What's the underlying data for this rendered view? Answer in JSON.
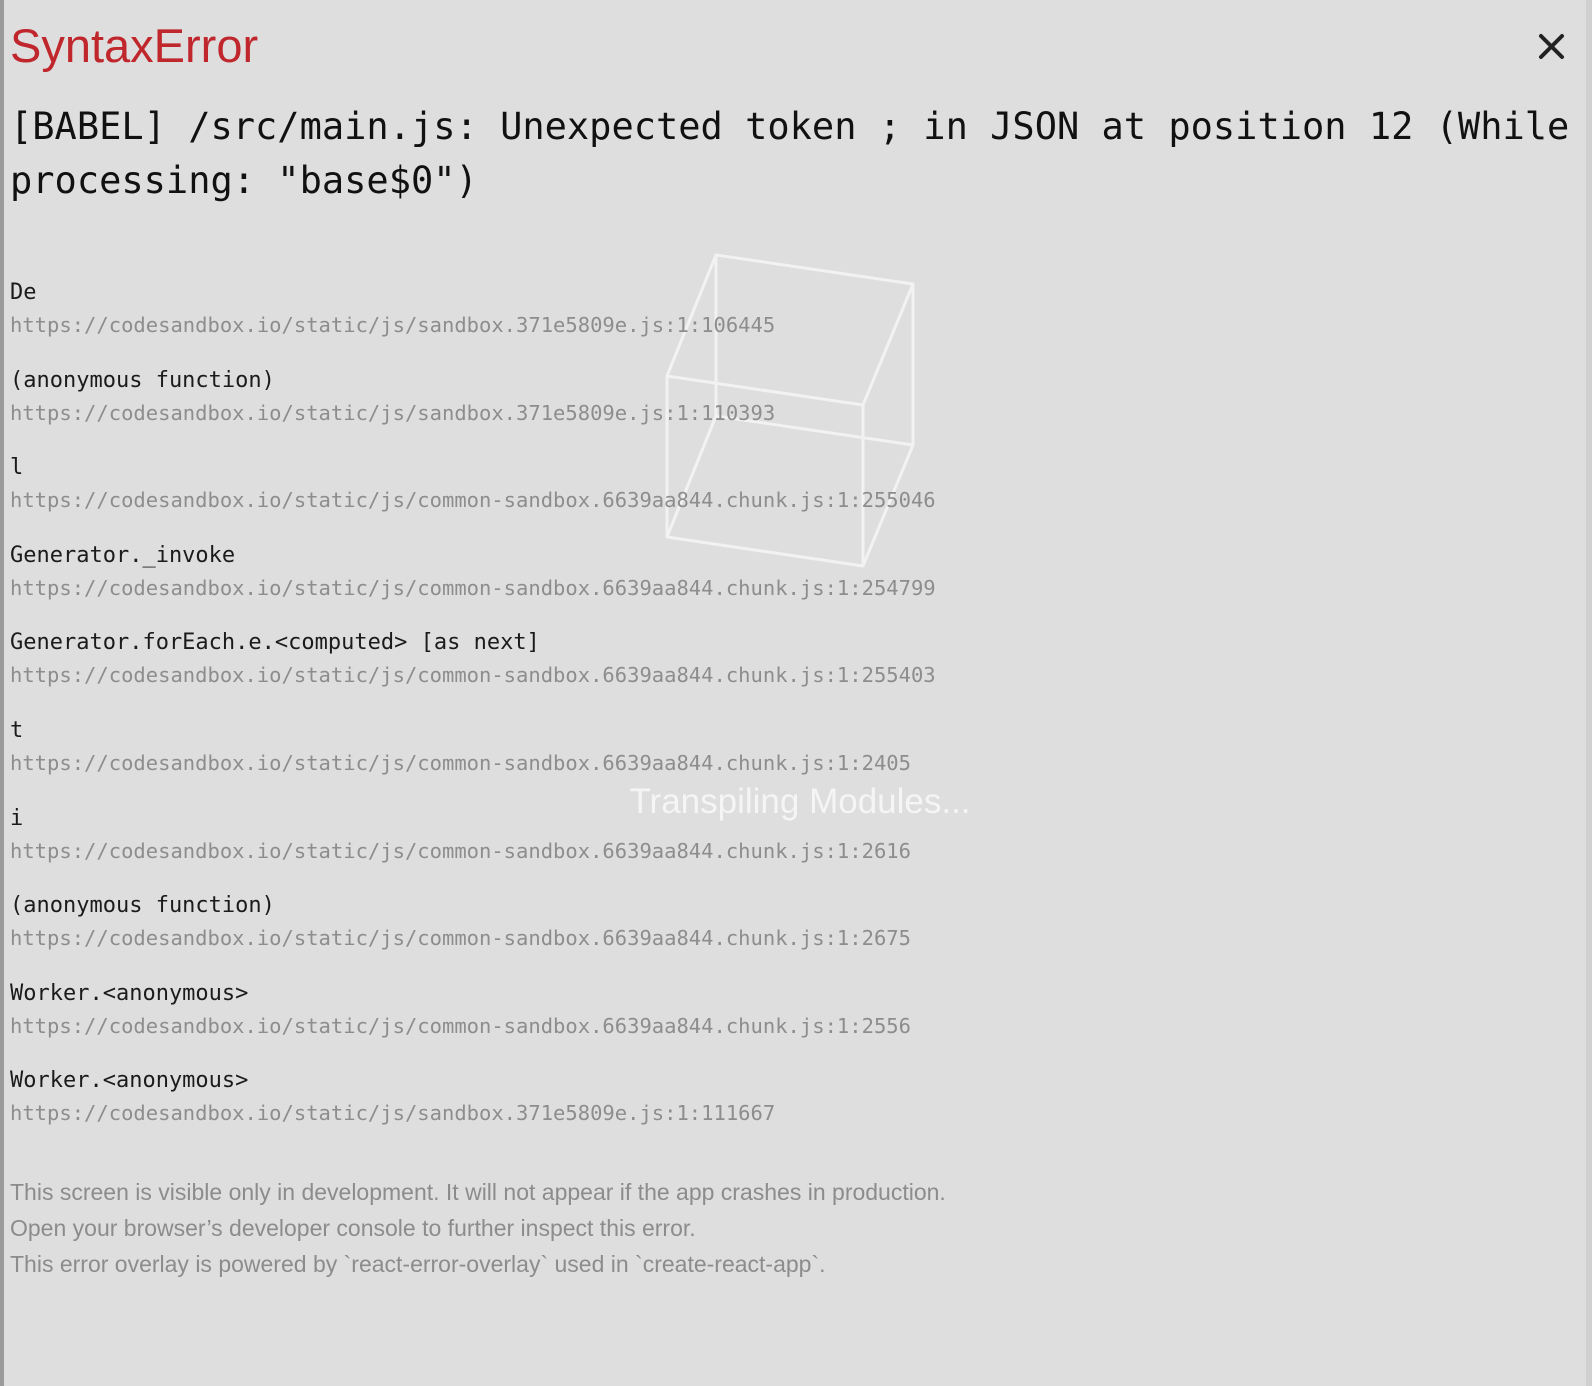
{
  "overlay": {
    "title": "SyntaxError",
    "message": "[BABEL] /src/main.js: Unexpected token ; in JSON at position 12 (While processing: \"base$0\")",
    "close_icon": "close-icon",
    "stack": [
      {
        "fn": "De",
        "loc": "https://codesandbox.io/static/js/sandbox.371e5809e.js:1:106445"
      },
      {
        "fn": "(anonymous function)",
        "loc": "https://codesandbox.io/static/js/sandbox.371e5809e.js:1:110393"
      },
      {
        "fn": "l",
        "loc": "https://codesandbox.io/static/js/common-sandbox.6639aa844.chunk.js:1:255046"
      },
      {
        "fn": "Generator._invoke",
        "loc": "https://codesandbox.io/static/js/common-sandbox.6639aa844.chunk.js:1:254799"
      },
      {
        "fn": "Generator.forEach.e.<computed> [as next]",
        "loc": "https://codesandbox.io/static/js/common-sandbox.6639aa844.chunk.js:1:255403"
      },
      {
        "fn": "t",
        "loc": "https://codesandbox.io/static/js/common-sandbox.6639aa844.chunk.js:1:2405"
      },
      {
        "fn": "i",
        "loc": "https://codesandbox.io/static/js/common-sandbox.6639aa844.chunk.js:1:2616"
      },
      {
        "fn": "(anonymous function)",
        "loc": "https://codesandbox.io/static/js/common-sandbox.6639aa844.chunk.js:1:2675"
      },
      {
        "fn": "Worker.<anonymous>",
        "loc": "https://codesandbox.io/static/js/common-sandbox.6639aa844.chunk.js:1:2556"
      },
      {
        "fn": "Worker.<anonymous>",
        "loc": "https://codesandbox.io/static/js/sandbox.371e5809e.js:1:111667"
      }
    ],
    "footer": [
      "This screen is visible only in development. It will not appear if the app crashes in production.",
      "Open your browser’s developer console to further inspect this error.",
      "This error overlay is powered by `react-error-overlay` used in `create-react-app`."
    ]
  },
  "loader": {
    "icon": "cube-icon",
    "text": "Transpiling Modules..."
  },
  "colors": {
    "background": "#dedede",
    "title": "#c0272d",
    "message": "#111111",
    "stack_location": "#8d8d8d",
    "footer": "#8c8c8c"
  }
}
